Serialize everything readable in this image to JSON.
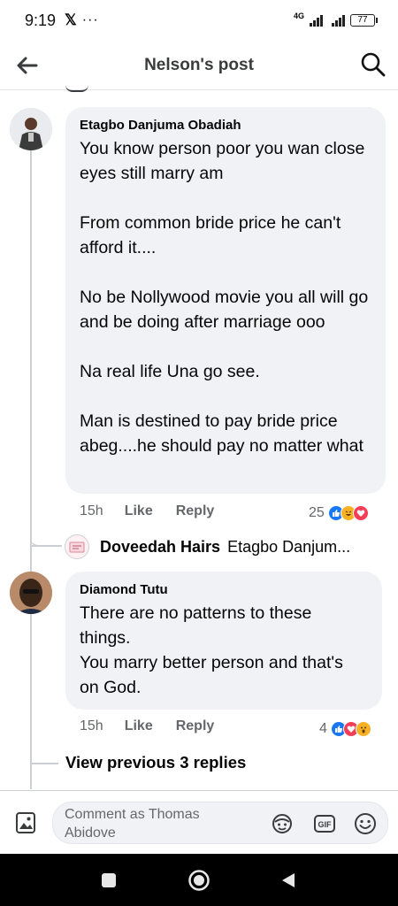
{
  "status_bar": {
    "time": "9:19",
    "x_glyph": "𝕏",
    "dots": "···",
    "network": "4G",
    "battery": "77"
  },
  "header": {
    "title": "Nelson's post"
  },
  "comments": [
    {
      "author": "Etagbo Danjuma Obadiah",
      "paragraphs": [
        "You know person poor you wan close eyes still marry am",
        "From common bride price he can't afford it....",
        "No be Nollywood movie you all will go and be doing after marriage ooo",
        "Na real life Una go see.",
        "Man is destined to pay bride price abeg....he should pay no matter what"
      ],
      "time": "15h",
      "like_label": "Like",
      "reply_label": "Reply",
      "reaction_count": "25",
      "reactions": [
        "like-reaction-icon",
        "haha-reaction-icon",
        "love-reaction-icon"
      ]
    },
    {
      "author": "Diamond Tutu",
      "paragraphs": [
        "There are no patterns to these things.\nYou marry better person and that's on God."
      ],
      "lines": [
        "There are no patterns to these",
        "things.",
        "You marry better person and that's",
        "on God."
      ],
      "time": "15h",
      "like_label": "Like",
      "reply_label": "Reply",
      "reaction_count": "4",
      "reactions": [
        "like-reaction-icon",
        "love-reaction-icon",
        "wow-reaction-icon"
      ]
    }
  ],
  "reply_preview": {
    "name": "Doveedah Hairs",
    "snippet": "Etagbo Danjum..."
  },
  "view_previous": "View previous 3 replies",
  "composer": {
    "placeholder_line1": "Comment as Thomas",
    "placeholder_line2": "Abidove"
  },
  "colors": {
    "like_blue": "#1877f2",
    "love_red": "#f33e58",
    "haha_yellow": "#f7b125",
    "bubble_bg": "#f0f2f5",
    "secondary_text": "#65676b"
  }
}
